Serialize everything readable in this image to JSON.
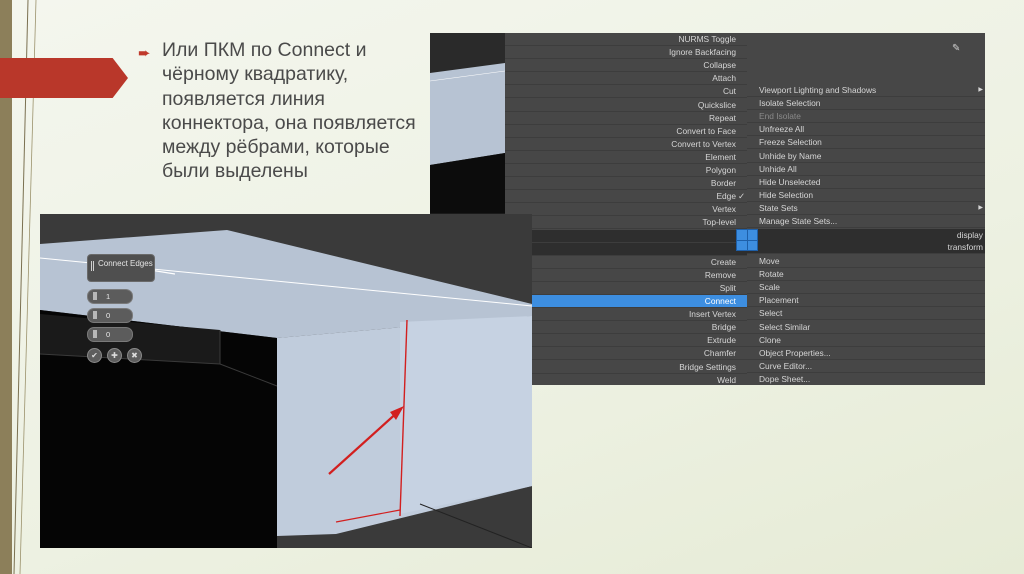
{
  "bullet": {
    "text": "Или ПКМ по Connect и чёрному квадратику, появляется линия коннектора, она появляется между рёбрами, которые были выделены"
  },
  "menu_left": [
    {
      "label": "NURMS Toggle",
      "state": "normal"
    },
    {
      "label": "Ignore Backfacing",
      "state": "normal"
    },
    {
      "label": "Collapse",
      "state": "normal"
    },
    {
      "label": "Attach",
      "state": "normal"
    },
    {
      "label": "Cut",
      "state": "normal"
    },
    {
      "label": "Quickslice",
      "state": "normal"
    },
    {
      "label": "Repeat",
      "state": "normal"
    },
    {
      "label": "Convert to Face",
      "state": "normal"
    },
    {
      "label": "Convert to Vertex",
      "state": "normal"
    },
    {
      "label": "Element",
      "state": "normal"
    },
    {
      "label": "Polygon",
      "state": "normal"
    },
    {
      "label": "Border",
      "state": "normal"
    },
    {
      "label": "Edge",
      "state": "checked"
    },
    {
      "label": "Vertex",
      "state": "normal"
    },
    {
      "label": "Top-level",
      "state": "normal"
    },
    {
      "label": "",
      "state": "divider"
    },
    {
      "label": "",
      "state": "divider"
    },
    {
      "label": "Create",
      "state": "normal"
    },
    {
      "label": "Remove",
      "state": "normal"
    },
    {
      "label": "Split",
      "state": "normal"
    },
    {
      "label": "Connect",
      "state": "selected"
    },
    {
      "label": "Insert Vertex",
      "state": "normal"
    },
    {
      "label": "Bridge",
      "state": "normal"
    },
    {
      "label": "Extrude",
      "state": "normal"
    },
    {
      "label": "Chamfer",
      "state": "normal"
    },
    {
      "label": "Bridge Settings",
      "state": "normal"
    },
    {
      "label": "Weld",
      "state": "normal"
    }
  ],
  "menu_right": [
    {
      "label": "Viewport Lighting and Shadows",
      "state": "submenu"
    },
    {
      "label": "Isolate Selection",
      "state": "normal"
    },
    {
      "label": "End Isolate",
      "state": "dim"
    },
    {
      "label": "Unfreeze All",
      "state": "normal"
    },
    {
      "label": "Freeze Selection",
      "state": "normal"
    },
    {
      "label": "Unhide by Name",
      "state": "normal"
    },
    {
      "label": "Unhide All",
      "state": "normal"
    },
    {
      "label": "Hide Unselected",
      "state": "normal"
    },
    {
      "label": "Hide Selection",
      "state": "normal"
    },
    {
      "label": "State Sets",
      "state": "submenu"
    },
    {
      "label": "Manage State Sets...",
      "state": "normal"
    },
    {
      "label": "display",
      "state": "header"
    },
    {
      "label": "transform",
      "state": "header"
    },
    {
      "label": "Move",
      "state": "normal"
    },
    {
      "label": "Rotate",
      "state": "normal"
    },
    {
      "label": "Scale",
      "state": "normal"
    },
    {
      "label": "Placement",
      "state": "normal"
    },
    {
      "label": "Select",
      "state": "normal"
    },
    {
      "label": "Select Similar",
      "state": "normal"
    },
    {
      "label": "Clone",
      "state": "normal"
    },
    {
      "label": "Object Properties...",
      "state": "normal"
    },
    {
      "label": "Curve Editor...",
      "state": "normal"
    },
    {
      "label": "Dope Sheet...",
      "state": "normal"
    }
  ],
  "connect_panel": {
    "title": "Connect Edges",
    "segments": "1",
    "pinch": "0",
    "slide": "0"
  },
  "colors": {
    "accent": "#b9372a",
    "selection": "#3d8ee0",
    "connector_line": "#d21f1f"
  }
}
